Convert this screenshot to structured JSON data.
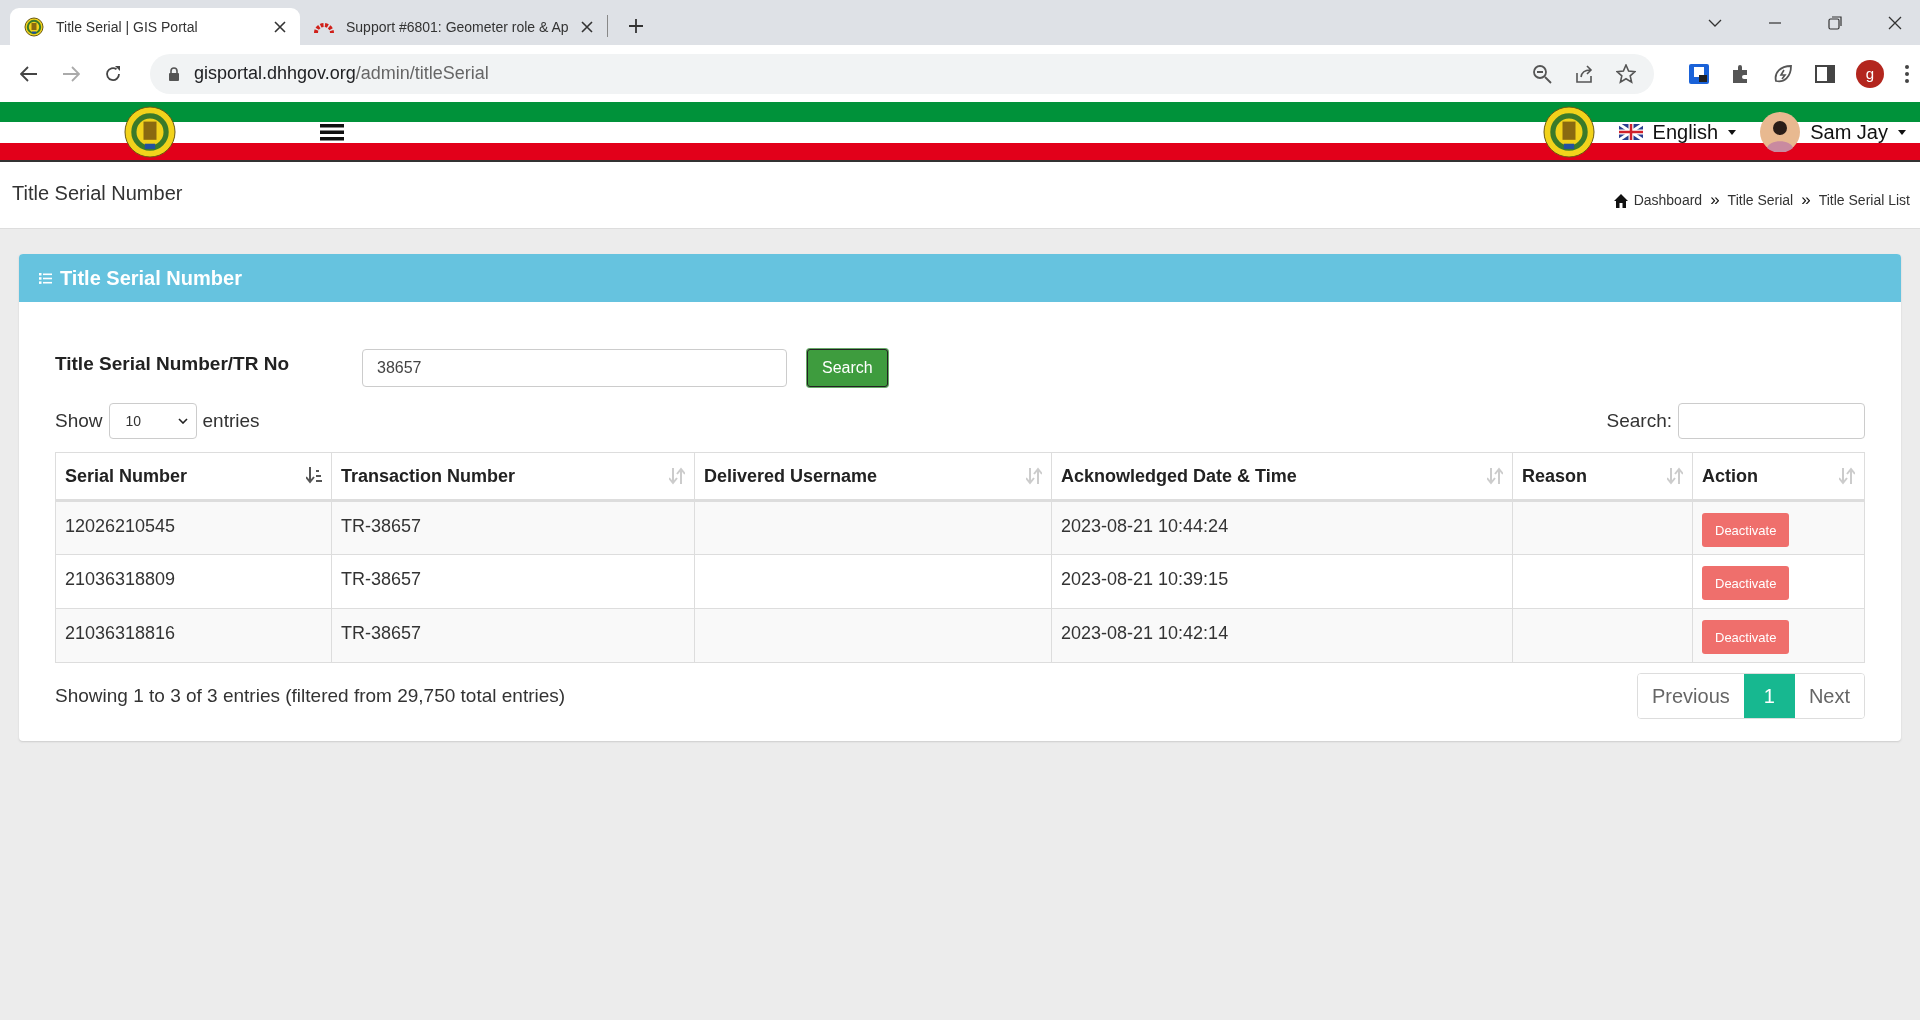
{
  "browser": {
    "tabs": [
      {
        "title": "Title Serial | GIS Portal",
        "selected": true,
        "kind": "emblem"
      },
      {
        "title": "Support #6801: Geometer role & Ap",
        "selected": false,
        "kind": "arc"
      }
    ],
    "url_host": "gisportal.dhhgov.org",
    "url_path": "/admin/titleSerial",
    "profile_initial": "g"
  },
  "header": {
    "language": "English",
    "user": "Sam Jay"
  },
  "page_title": "Title Serial Number",
  "breadcrumbs": [
    "Dashboard",
    "Title Serial",
    "Title Serial List"
  ],
  "breadcrumb_separators": [
    "»",
    "»"
  ],
  "panel": {
    "title": "Title Serial Number",
    "filter": {
      "label": "Title Serial Number/TR No",
      "value": "38657",
      "button": "Search"
    },
    "length": {
      "before": "Show",
      "value": "10",
      "after": "entries"
    },
    "search_label": "Search:",
    "table": {
      "columns": [
        {
          "label": "Serial Number",
          "sorted": true
        },
        {
          "label": "Transaction Number",
          "sorted": false
        },
        {
          "label": "Delivered Username",
          "sorted": false
        },
        {
          "label": "Acknowledged Date & Time",
          "sorted": false
        },
        {
          "label": "Reason",
          "sorted": false
        },
        {
          "label": "Action",
          "sorted": false
        }
      ],
      "rows": [
        {
          "serial": "12026210545",
          "transaction": "TR-38657",
          "acknowledged": "2023-08-21 10:44:24",
          "action": "Deactivate"
        },
        {
          "serial": "21036318809",
          "transaction": "TR-38657",
          "acknowledged": "2023-08-21 10:39:15",
          "action": "Deactivate"
        },
        {
          "serial": "21036318816",
          "transaction": "TR-38657",
          "acknowledged": "2023-08-21 10:42:14",
          "action": "Deactivate"
        }
      ]
    },
    "info": "Showing 1 to 3 of 3 entries (filtered from 29,750 total entries)",
    "pagination": [
      {
        "label": "Previous",
        "selected": false
      },
      {
        "label": "1",
        "selected": true
      },
      {
        "label": "Next",
        "selected": false
      }
    ]
  }
}
